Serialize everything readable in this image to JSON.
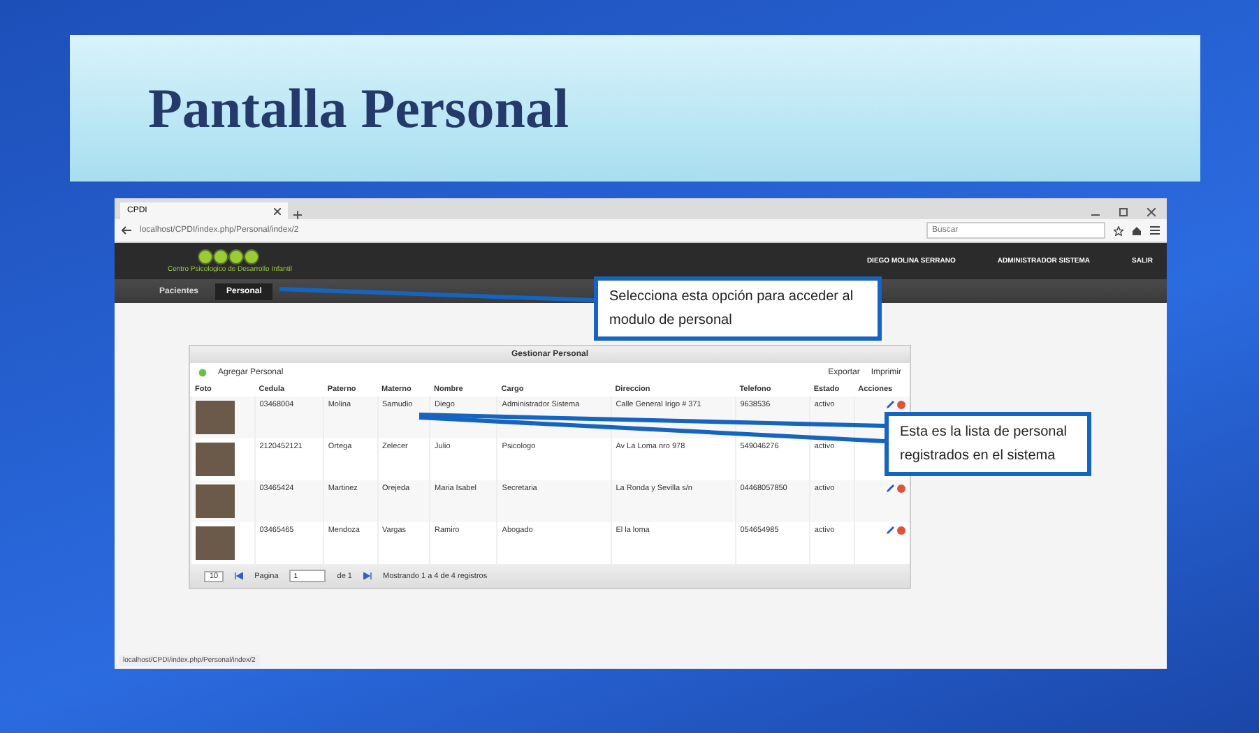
{
  "slide": {
    "title": "Pantalla Personal"
  },
  "browser": {
    "tab_title": "CPDI",
    "url": "localhost/CPDI/index.php/Personal/index/2",
    "search": {
      "placeholder": "Buscar"
    },
    "status_url": "localhost/CPDI/index.php/Personal/index/2"
  },
  "app_header": {
    "logo_caption": "Centro Psicologico de Desarrollo Infantil",
    "user": "DIEGO MOLINA SERRANO",
    "role": "ADMINISTRADOR SISTEMA",
    "logout": "SALIR"
  },
  "nav": [
    {
      "label": "Pacientes",
      "selected": false
    },
    {
      "label": "Personal",
      "selected": true
    }
  ],
  "panel": {
    "title": "Gestionar Personal",
    "add_button": "Agregar Personal",
    "export_button": "Exportar",
    "print_button": "Imprimir",
    "columns": [
      "Foto",
      "Cedula",
      "Paterno",
      "Materno",
      "Nombre",
      "Cargo",
      "Direccion",
      "Telefono",
      "Estado",
      "Acciones"
    ],
    "rows": [
      {
        "cedula": "03468004",
        "paterno": "Molina",
        "materno": "Samudio",
        "nombre": "Diego",
        "cargo": "Administrador Sistema",
        "direccion": "Calle General Irigo # 371",
        "telefono": "9638536",
        "estado": "activo"
      },
      {
        "cedula": "2120452121",
        "paterno": "Ortega",
        "materno": "Zelecer",
        "nombre": "Julio",
        "cargo": "Psicologo",
        "direccion": "Av La Loma nro 978",
        "telefono": "549046276",
        "estado": "activo"
      },
      {
        "cedula": "03465424",
        "paterno": "Martinez",
        "materno": "Orejeda",
        "nombre": "Maria Isabel",
        "cargo": "Secretaria",
        "direccion": "La Ronda y Sevilla s/n",
        "telefono": "04468057850",
        "estado": "activo"
      },
      {
        "cedula": "03465465",
        "paterno": "Mendoza",
        "materno": "Vargas",
        "nombre": "Ramiro",
        "cargo": "Abogado",
        "direccion": "El la loma",
        "telefono": "054654985",
        "estado": "activo"
      }
    ],
    "pager": {
      "page_size": "10",
      "page_label": "Pagina",
      "page": "1",
      "of_pages": "de 1",
      "summary": "Mostrando 1 a 4 de 4 registros"
    }
  },
  "callouts": [
    "Selecciona esta opción para acceder al modulo de personal",
    "Esta es la lista de personal registrados en el sistema"
  ]
}
